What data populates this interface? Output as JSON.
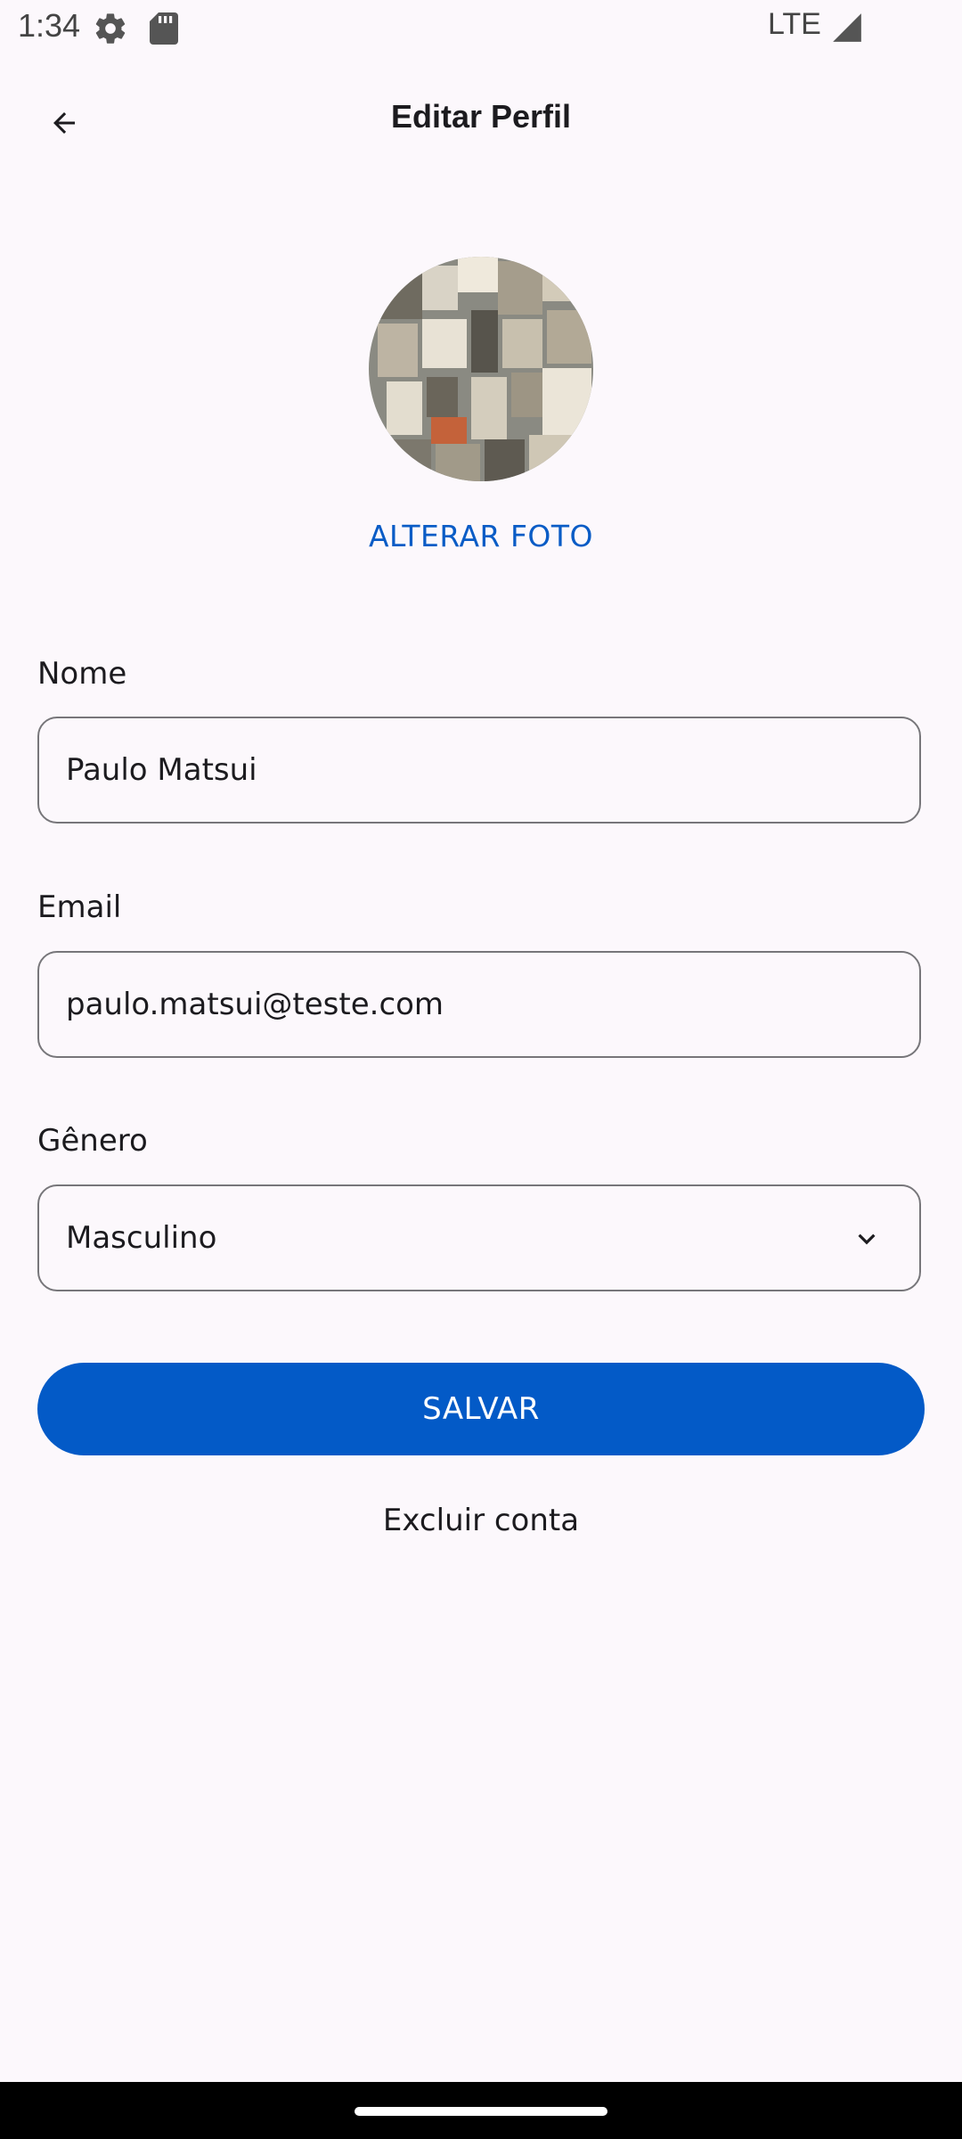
{
  "status_bar": {
    "time": "1:34",
    "network": "LTE",
    "icons": [
      "settings-gear-icon",
      "sd-card-icon",
      "signal-icon"
    ]
  },
  "app_bar": {
    "title": "Editar Perfil",
    "back_icon": "arrow-back-icon"
  },
  "profile": {
    "change_photo_label": "ALTERAR FOTO"
  },
  "form": {
    "name": {
      "label": "Nome",
      "value": "Paulo Matsui"
    },
    "email": {
      "label": "Email",
      "value": "paulo.matsui@teste.com"
    },
    "gender": {
      "label": "Gênero",
      "selected": "Masculino",
      "icon": "chevron-down-icon"
    }
  },
  "actions": {
    "save_label": "SALVAR",
    "delete_label": "Excluir conta"
  },
  "colors": {
    "primary": "#035ac7",
    "link": "#0a5cc6",
    "background": "#fcf8fc",
    "outline": "#77767a"
  }
}
